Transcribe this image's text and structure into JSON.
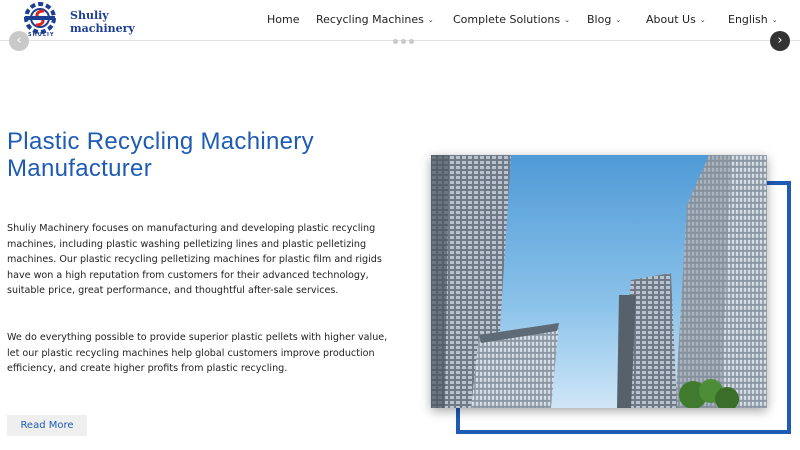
{
  "brand": {
    "name_line1": "Shuliy",
    "name_line2": "machinery",
    "sub": "SHULIY"
  },
  "nav": {
    "items": [
      {
        "label": "Home",
        "has_dropdown": false
      },
      {
        "label": "Recycling Machines",
        "has_dropdown": true
      },
      {
        "label": "Complete Solutions",
        "has_dropdown": true
      },
      {
        "label": "Blog",
        "has_dropdown": true
      },
      {
        "label": "About Us",
        "has_dropdown": true
      },
      {
        "label": "English",
        "has_dropdown": true
      }
    ],
    "chevron": "⌄"
  },
  "slider": {
    "prev_icon": "‹",
    "next_icon": "›"
  },
  "hero": {
    "title": "Plastic Recycling Machinery Manufacturer",
    "paragraph1": "Shuliy Machinery focuses on manufacturing and developing plastic recycling machines, including plastic washing pelletizing lines and plastic pelletizing machines. Our plastic recycling pelletizing machines for plastic film and rigids have won a high reputation from customers for their advanced technology, suitable price, great performance, and thoughtful after-sale services.",
    "paragraph2": "We do everything possible to provide superior plastic pellets with higher value, let our plastic recycling machines help global customers improve production efficiency, and create higher profits from plastic recycling.",
    "button_label": "Read More"
  },
  "colors": {
    "accent": "#1e5bb4",
    "brand": "#1d3f93",
    "logo_red": "#d7261e"
  }
}
